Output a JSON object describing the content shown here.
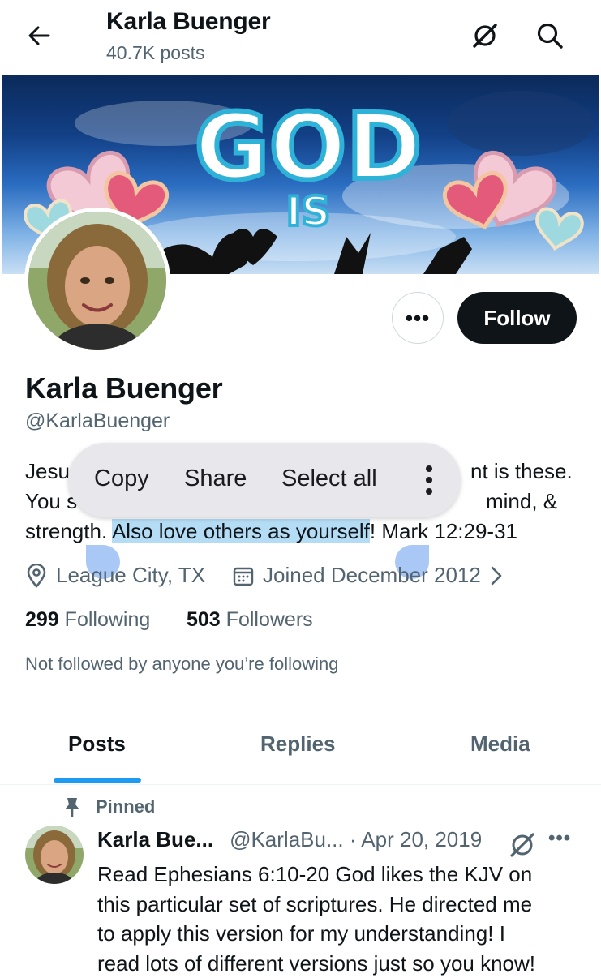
{
  "header": {
    "name": "Karla Buenger",
    "post_count": "40.7K posts"
  },
  "banner": {
    "text_big": "GOD",
    "text_small": "IS"
  },
  "actions": {
    "more": "•••",
    "follow": "Follow"
  },
  "profile": {
    "name": "Karla Buenger",
    "handle": "@KarlaBuenger"
  },
  "bio": {
    "line1_start": "Jesu",
    "line1_end": "nt is these.",
    "line2_start": "You s",
    "line2_end": "mind, &",
    "line3_before": "strength. ",
    "line3_selected": "Also love others as yourself",
    "line3_after": "! Mark 12:29-31"
  },
  "context_menu": {
    "copy": "Copy",
    "share": "Share",
    "select_all": "Select all"
  },
  "meta": {
    "location": "League City, TX",
    "joined": "Joined December 2012"
  },
  "stats": {
    "following_count": "299",
    "following_label": "Following",
    "followers_count": "503",
    "followers_label": "Followers"
  },
  "not_followed": "Not followed by anyone you’re following",
  "tabs": [
    {
      "label": "Posts",
      "active": true
    },
    {
      "label": "Replies",
      "active": false
    },
    {
      "label": "Media",
      "active": false
    }
  ],
  "post": {
    "pinned_label": "Pinned",
    "author": "Karla Bue...",
    "meta": "@KarlaBu... · Apr 20, 2019",
    "more": "•••",
    "lines": [
      "Read Ephesians 6:10-20 God likes the KJV on",
      "this particular set of scriptures. He directed me",
      "to apply this version for my understanding! I",
      "read lots of different versions just so you know!"
    ]
  },
  "colors": {
    "accent": "#1d9bf0",
    "text_primary": "#0f1419",
    "text_secondary": "#536471",
    "selection": "#b4dcf5",
    "follow_button": "#0f1419"
  },
  "icons": {
    "back": "arrow-left-icon",
    "grok": "grok-icon",
    "search": "search-icon",
    "location": "location-pin-icon",
    "calendar": "calendar-icon",
    "chevron": "chevron-right-icon",
    "pin": "pin-icon"
  }
}
